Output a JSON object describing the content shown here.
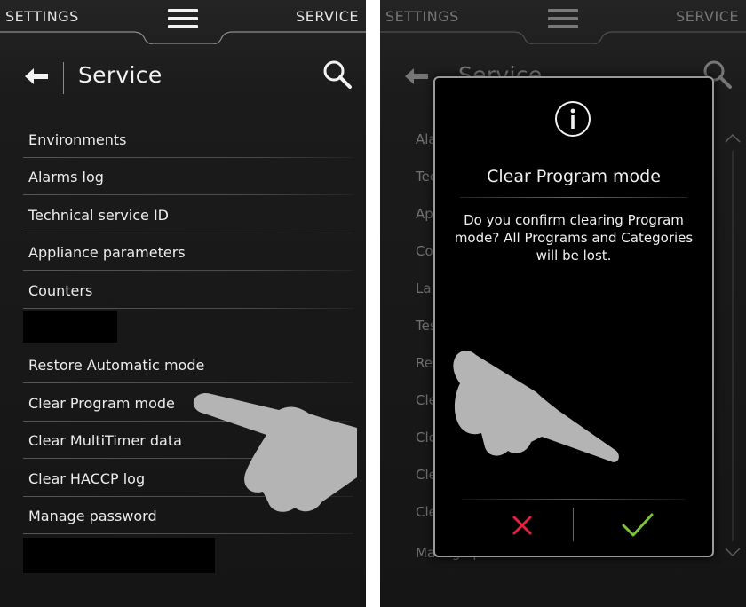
{
  "topbar": {
    "left_label": "SETTINGS",
    "right_label": "SERVICE"
  },
  "header": {
    "title": "Service"
  },
  "service_list": [
    "Environments",
    "Alarms log",
    "Technical service ID",
    "Appliance parameters",
    "Counters",
    "",
    "Restore Automatic mode",
    "Clear Program mode",
    "Clear MultiTimer data",
    "Clear HACCP log",
    "Manage password",
    ""
  ],
  "background_list_fragments": [
    "Ala",
    "Tec",
    "Ap",
    "Co",
    "La",
    "Tes",
    "Re",
    "Cle",
    "Cle",
    "Cle",
    "Cle"
  ],
  "background_bottom_text": "Manage passwords",
  "dialog": {
    "title": "Clear Program mode",
    "message": "Do you confirm clearing Program mode? All Programs and Categories will be lost.",
    "cancel_icon": "cross-icon",
    "confirm_icon": "check-icon"
  },
  "colors": {
    "panel_background": "#1b1b1b",
    "text": "#ececec",
    "cancel_red": "#e2243b",
    "confirm_green": "#7cc23a",
    "hand_gray": "#b4b4b4"
  }
}
